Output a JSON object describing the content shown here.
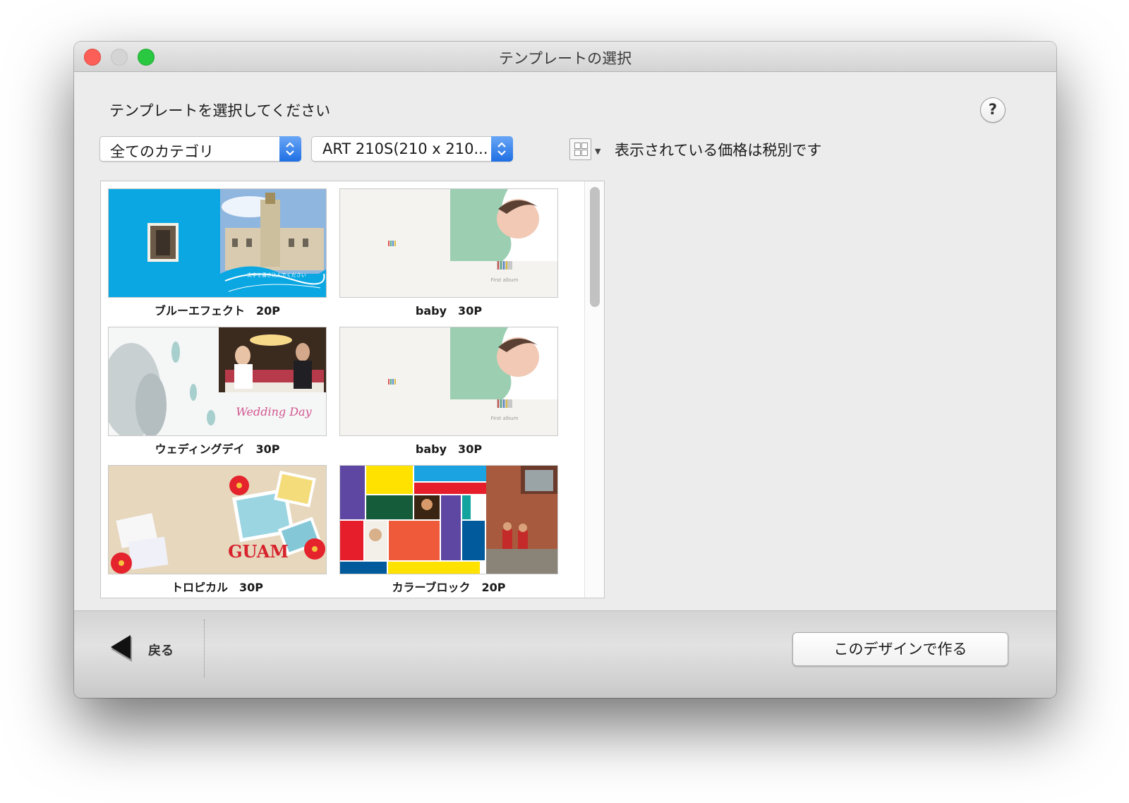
{
  "window": {
    "title": "テンプレートの選択"
  },
  "header": {
    "prompt": "テンプレートを選択してください",
    "help_label": "?",
    "category_select": {
      "value": "全てのカテゴリ"
    },
    "size_select": {
      "value": "ART 210S(210 x 210..."
    },
    "tax_note": "表示されている価格は税別です",
    "view_menu_icon": "grid-icon"
  },
  "templates": [
    {
      "name": "ブルーエフェクト　20P"
    },
    {
      "name": "baby　30P"
    },
    {
      "name": "ウェディングデイ　30P"
    },
    {
      "name": "baby　30P"
    },
    {
      "name": "トロピカル　30P"
    },
    {
      "name": "カラーブロック　20P"
    }
  ],
  "thumb_text": {
    "blue_effect_caption": "文字を書き込んでください",
    "baby_caption": "First album",
    "wedding_caption": "Wedding Day",
    "guam_caption": "GUAM"
  },
  "footer": {
    "back_label": "戻る",
    "create_label": "このデザインで作る"
  },
  "colors": {
    "accent_blue": "#1f6fe3",
    "blue_effect_bg": "#0aa7e2",
    "close": "#fc5f57",
    "maximize": "#29c840"
  }
}
